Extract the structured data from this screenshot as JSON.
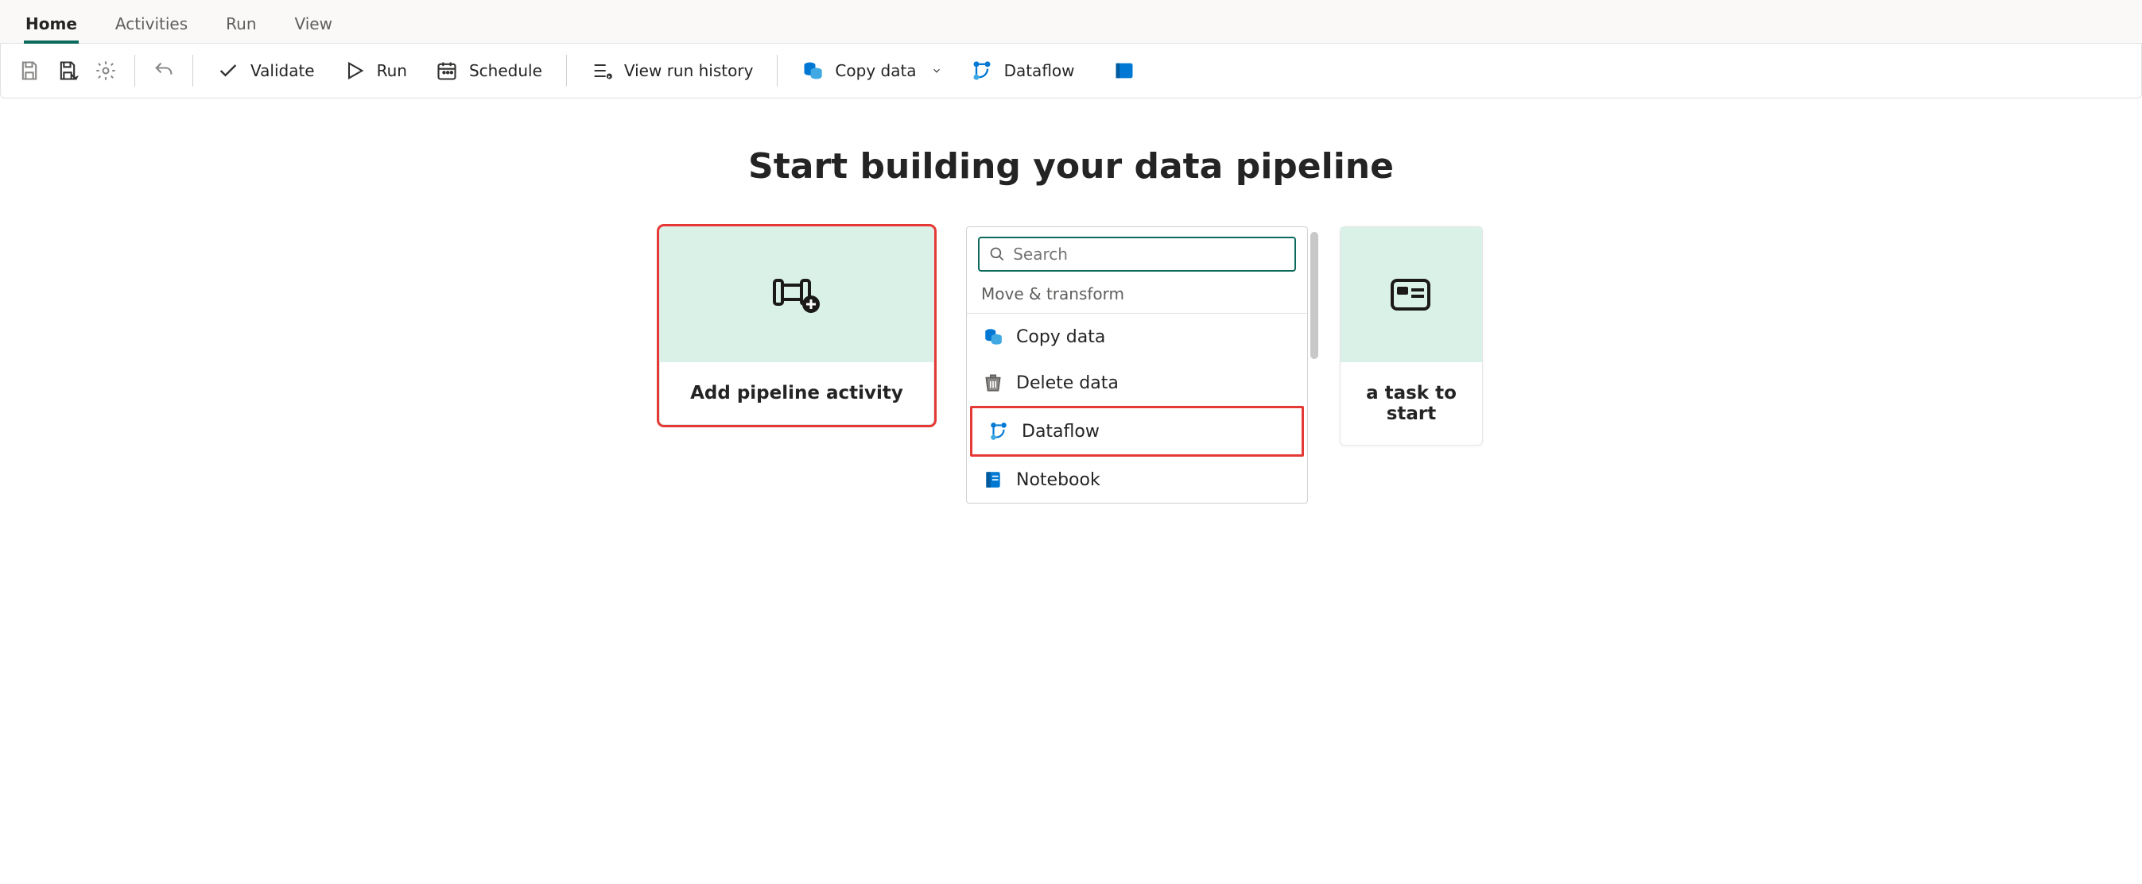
{
  "tabs": [
    "Home",
    "Activities",
    "Run",
    "View"
  ],
  "activeTab": 0,
  "toolbar": {
    "validate": "Validate",
    "run": "Run",
    "schedule": "Schedule",
    "viewRunHistory": "View run history",
    "copyData": "Copy data",
    "dataflow": "Dataflow"
  },
  "page": {
    "heading": "Start building your data pipeline",
    "addActivity": "Add pipeline activity",
    "taskToStart": "a task to start"
  },
  "popup": {
    "searchPlaceholder": "Search",
    "groupLabel": "Move & transform",
    "items": {
      "copyData": "Copy data",
      "deleteData": "Delete data",
      "dataflow": "Dataflow",
      "notebook": "Notebook"
    }
  }
}
